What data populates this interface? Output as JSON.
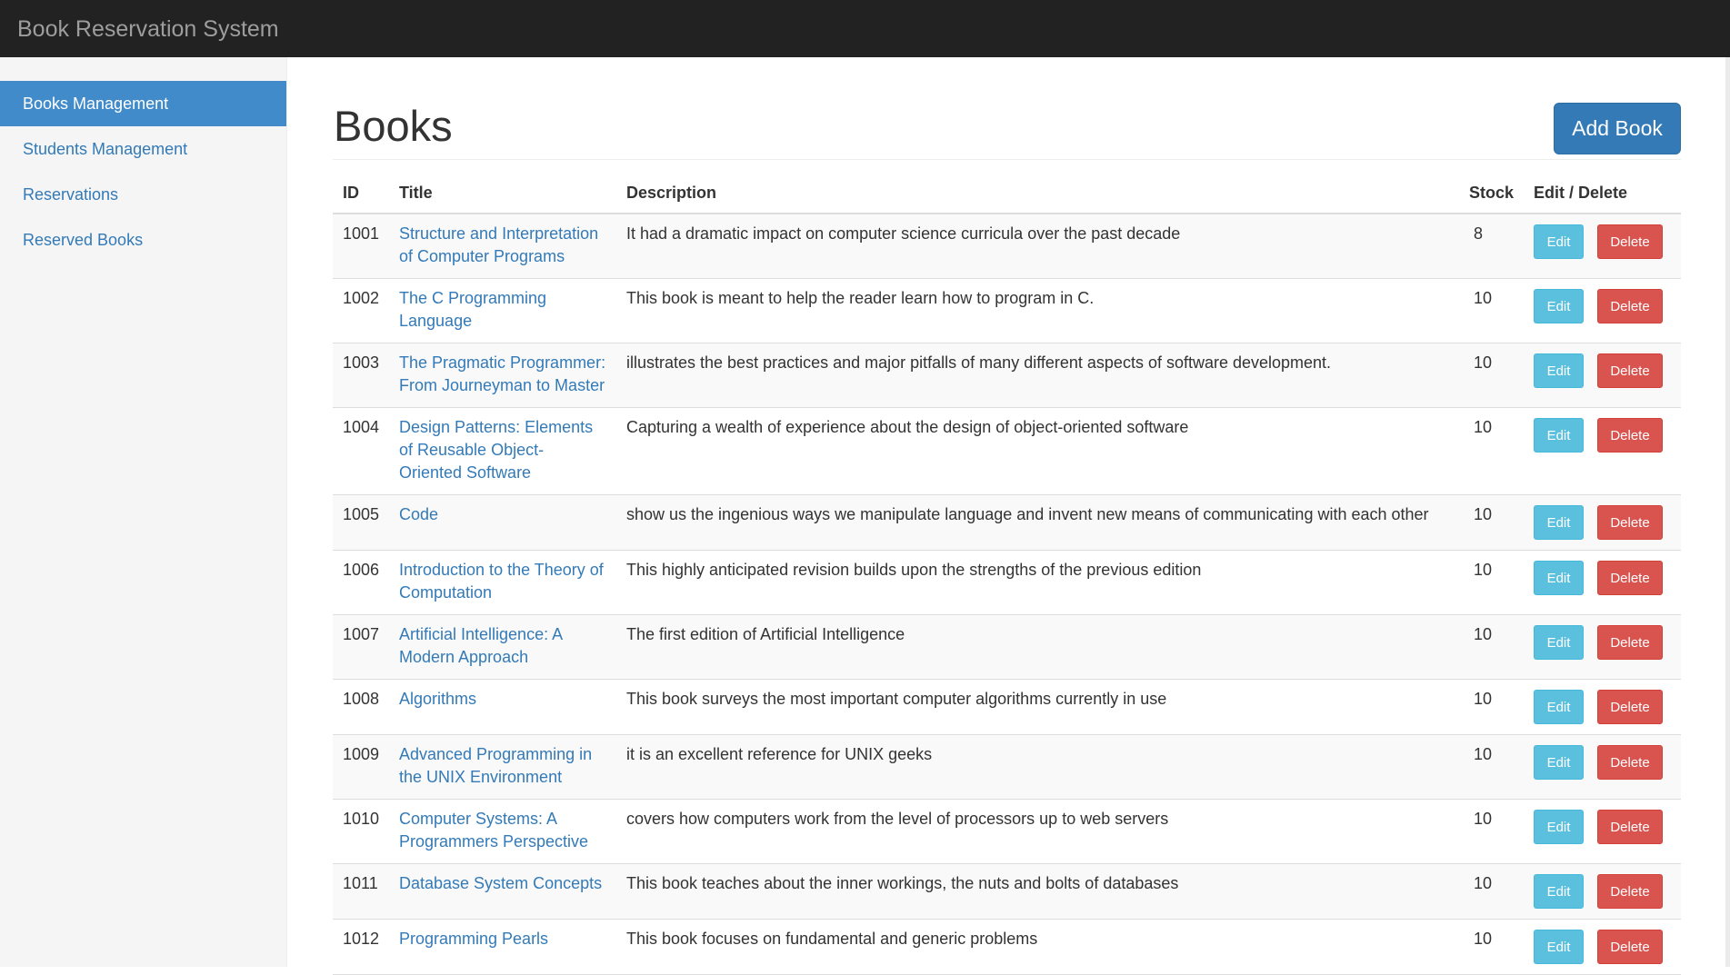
{
  "navbar": {
    "brand": "Book Reservation System"
  },
  "sidebar": {
    "items": [
      {
        "label": "Books Management",
        "active": true
      },
      {
        "label": "Students Management",
        "active": false
      },
      {
        "label": "Reservations",
        "active": false
      },
      {
        "label": "Reserved Books",
        "active": false
      }
    ]
  },
  "main": {
    "title": "Books",
    "add_button_label": "Add Book",
    "table": {
      "headers": {
        "id": "ID",
        "title": "Title",
        "description": "Description",
        "stock": "Stock",
        "actions": "Edit / Delete"
      },
      "edit_label": "Edit",
      "delete_label": "Delete",
      "rows": [
        {
          "id": "1001",
          "title": "Structure and Interpretation of Computer Programs",
          "description": "It had a dramatic impact on computer science curricula over the past decade",
          "stock": "8"
        },
        {
          "id": "1002",
          "title": "The C Programming Language",
          "description": "This book is meant to help the reader learn how to program in C.",
          "stock": "10"
        },
        {
          "id": "1003",
          "title": "The Pragmatic Programmer: From Journeyman to Master",
          "description": "illustrates the best practices and major pitfalls of many different aspects of software development.",
          "stock": "10"
        },
        {
          "id": "1004",
          "title": "Design Patterns: Elements of Reusable Object-Oriented Software",
          "description": "Capturing a wealth of experience about the design of object-oriented software",
          "stock": "10"
        },
        {
          "id": "1005",
          "title": "Code",
          "description": "show us the ingenious ways we manipulate language and invent new means of communicating with each other",
          "stock": "10"
        },
        {
          "id": "1006",
          "title": "Introduction to the Theory of Computation",
          "description": "This highly anticipated revision builds upon the strengths of the previous edition",
          "stock": "10"
        },
        {
          "id": "1007",
          "title": "Artificial Intelligence: A Modern Approach",
          "description": "The first edition of Artificial Intelligence",
          "stock": "10"
        },
        {
          "id": "1008",
          "title": "Algorithms",
          "description": "This book surveys the most important computer algorithms currently in use",
          "stock": "10"
        },
        {
          "id": "1009",
          "title": "Advanced Programming in the UNIX Environment",
          "description": "it is an excellent reference for UNIX geeks",
          "stock": "10"
        },
        {
          "id": "1010",
          "title": "Computer Systems: A Programmers Perspective",
          "description": "covers how computers work from the level of processors up to web servers",
          "stock": "10"
        },
        {
          "id": "1011",
          "title": "Database System Concepts",
          "description": "This book teaches about the inner workings, the nuts and bolts of databases",
          "stock": "10"
        },
        {
          "id": "1012",
          "title": "Programming Pearls",
          "description": "This book focuses on fundamental and generic problems",
          "stock": "10"
        }
      ]
    }
  },
  "colors": {
    "navbar_bg": "#222222",
    "sidebar_active": "#428bca",
    "link": "#337ab7",
    "edit_button": "#5bc0de",
    "delete_button": "#d9534f"
  }
}
